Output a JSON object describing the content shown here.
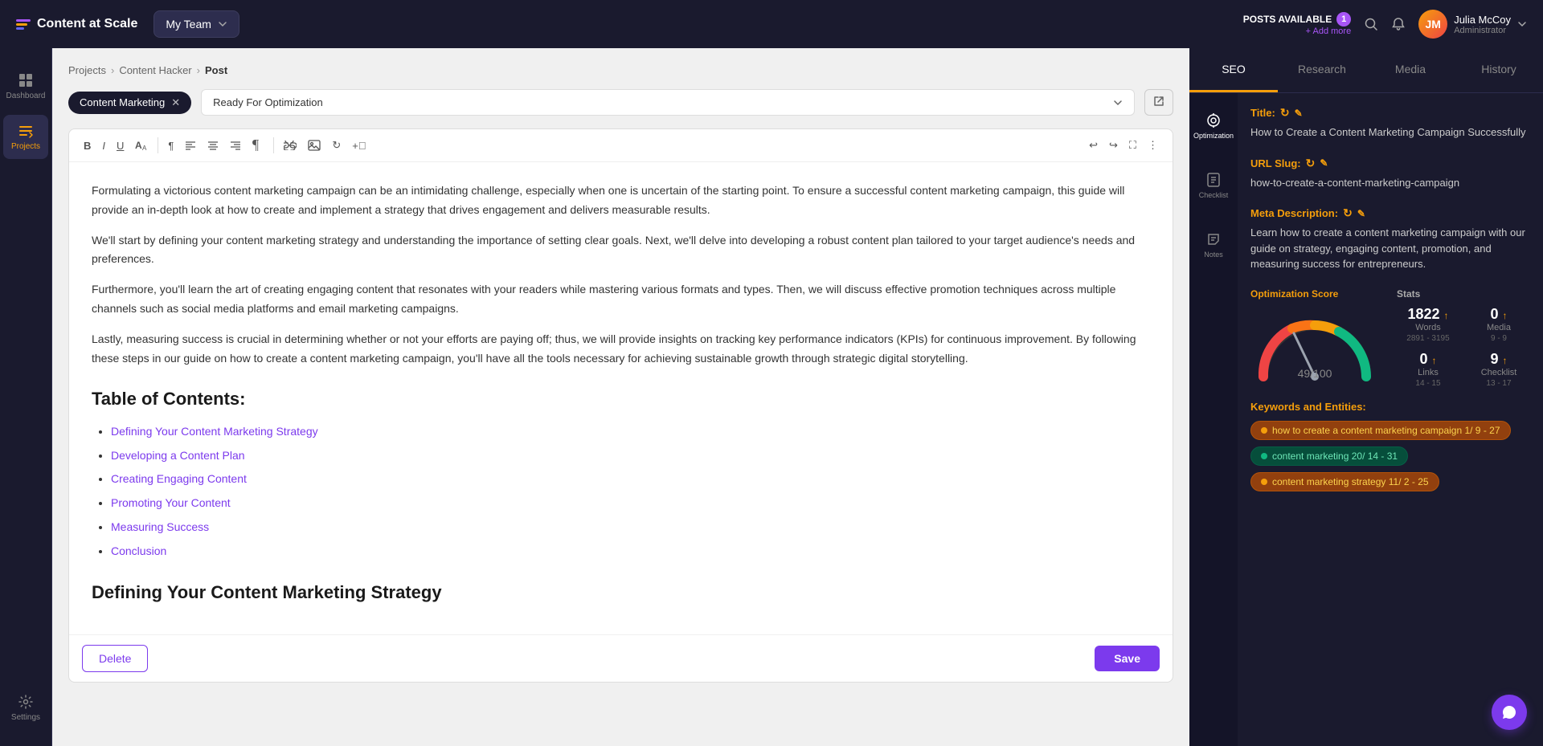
{
  "app": {
    "name": "Content at Scale"
  },
  "topnav": {
    "team_label": "My Team",
    "posts_available_label": "POSTS AVAILABLE",
    "posts_count": "1",
    "add_more": "+ Add more",
    "user_name": "Julia McCoy",
    "user_role": "Administrator"
  },
  "sidebar": {
    "items": [
      {
        "id": "dashboard",
        "label": "Dashboard",
        "active": false
      },
      {
        "id": "projects",
        "label": "Projects",
        "active": true
      },
      {
        "id": "settings",
        "label": "Settings",
        "active": false
      }
    ]
  },
  "breadcrumb": {
    "items": [
      "Projects",
      "Content Hacker",
      "Post"
    ]
  },
  "toolbar": {
    "tag_label": "Content Marketing",
    "status_label": "Ready For Optimization",
    "delete_label": "Delete",
    "save_label": "Save"
  },
  "editor": {
    "paragraphs": [
      "Formulating a victorious content marketing campaign can be an intimidating challenge, especially when one is uncertain of the starting point. To ensure a successful content marketing campaign, this guide will provide an in-depth look at how to create and implement a strategy that drives engagement and delivers measurable results.",
      "We'll start by defining your content marketing strategy and understanding the importance of setting clear goals. Next, we'll delve into developing a robust content plan tailored to your target audience's needs and preferences.",
      "Furthermore, you'll learn the art of creating engaging content that resonates with your readers while mastering various formats and types. Then, we will discuss effective promotion techniques across multiple channels such as social media platforms and email marketing campaigns.",
      "Lastly, measuring success is crucial in determining whether or not your efforts are paying off; thus, we will provide insights on tracking key performance indicators (KPIs) for continuous improvement. By following these steps in our guide on how to create a content marketing campaign, you'll have all the tools necessary for achieving sustainable growth through strategic digital storytelling."
    ],
    "toc_heading": "Table of Contents:",
    "toc_items": [
      "Defining Your Content Marketing Strategy",
      "Developing a Content Plan",
      "Creating Engaging Content",
      "Promoting Your Content",
      "Measuring Success",
      "Conclusion"
    ],
    "section_heading": "Defining Your Content Marketing Strategy"
  },
  "right_panel": {
    "tabs": [
      "SEO",
      "Research",
      "Media",
      "History"
    ],
    "active_tab": "SEO",
    "opt_icons": [
      "Optimization",
      "Checklist",
      "Notes"
    ],
    "title_label": "Title:",
    "title_value": "How to Create a Content Marketing Campaign Successfully",
    "url_slug_label": "URL Slug:",
    "url_slug_value": "how-to-create-a-content-marketing-campaign",
    "meta_desc_label": "Meta Description:",
    "meta_desc_value": "Learn how to create a content marketing campaign with our guide on strategy, engaging content, promotion, and measuring success for entrepreneurs.",
    "opt_score_label": "Optimization Score",
    "opt_score": "49",
    "opt_score_max": "100",
    "stats_label": "Stats",
    "words_value": "1822",
    "words_label": "Words",
    "words_range": "2891 - 3195",
    "media_value": "0",
    "media_label": "Media",
    "media_range": "9 - 9",
    "links_value": "0",
    "links_label": "Links",
    "links_range": "14 - 15",
    "checklist_value": "9",
    "checklist_label": "Checklist",
    "checklist_range": "13 - 17",
    "keywords_label": "Keywords and Entities:",
    "keyword_tags": [
      {
        "text": "how to create a content marketing campaign 1/ 9 - 27",
        "type": "yellow"
      },
      {
        "text": "content marketing 20/ 14 - 31",
        "type": "green"
      },
      {
        "text": "content marketing strategy 11/ 2 - 25",
        "type": "yellow"
      }
    ]
  }
}
